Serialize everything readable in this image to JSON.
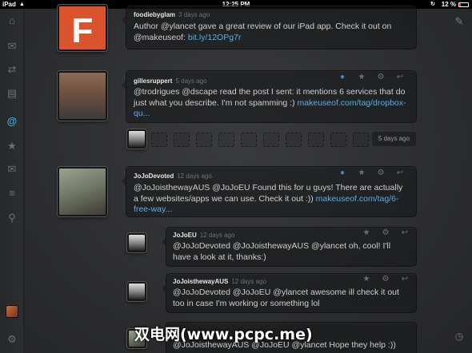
{
  "statusbar": {
    "device": "iPad",
    "time": "12:25 PM",
    "battery": "12 %"
  },
  "tweets": [
    {
      "user": "foodiebyglam",
      "time": "3 days ago",
      "text_pre": "Author @ylancet gave a great review of our iPad app. Check it out on @makeuseof: ",
      "link": "bit.ly/12OPg7r",
      "avatar_letter": "F"
    },
    {
      "user": "gillesruppert",
      "time": "5 days ago",
      "text_pre": "@trodrigues @dscape read the post I sent: it mentions 6 services that do just what you describe. I'm not spamming :) ",
      "link": "makeuseof.com/tag/dropbox-qu..."
    },
    {
      "user": "JoJoDevoted",
      "time": "12 days ago",
      "text_pre": "@JoJoisthewayAUS @JoJoEU Found this for u guys! There are actually a few websites/apps we can use. Check it out :)) ",
      "link": "makeuseof.com/tag/6-free-way..."
    },
    {
      "user": "JoJoEU",
      "time": "12 days ago",
      "text_pre": "@JoJoDevoted @JoJoisthewayAUS @ylancet oh, cool! I'll have a look at it, thanks:)",
      "link": ""
    },
    {
      "user": "JoJoisthewayAUS",
      "time": "12 days ago",
      "text_pre": "@JoJoDevoted @JoJoEU @ylancet awesome ill check it out too in case I'm working or something lol",
      "link": ""
    },
    {
      "user": "",
      "time": "",
      "text_pre": "@JoJoisthewayAUS @JoJoEU @ylancet  Hope they help :))",
      "link": ""
    }
  ],
  "gap": {
    "time": "5 days ago"
  },
  "icons": {
    "home": "home-icon",
    "mentions": "at-icon",
    "compose": "compose-icon",
    "clock": "clock-icon"
  },
  "colors": {
    "link": "#5aaee6",
    "active": "#3fa8e0",
    "avatar_f": "#d9532c"
  },
  "watermark": "双电网(www.pcpc.me)"
}
